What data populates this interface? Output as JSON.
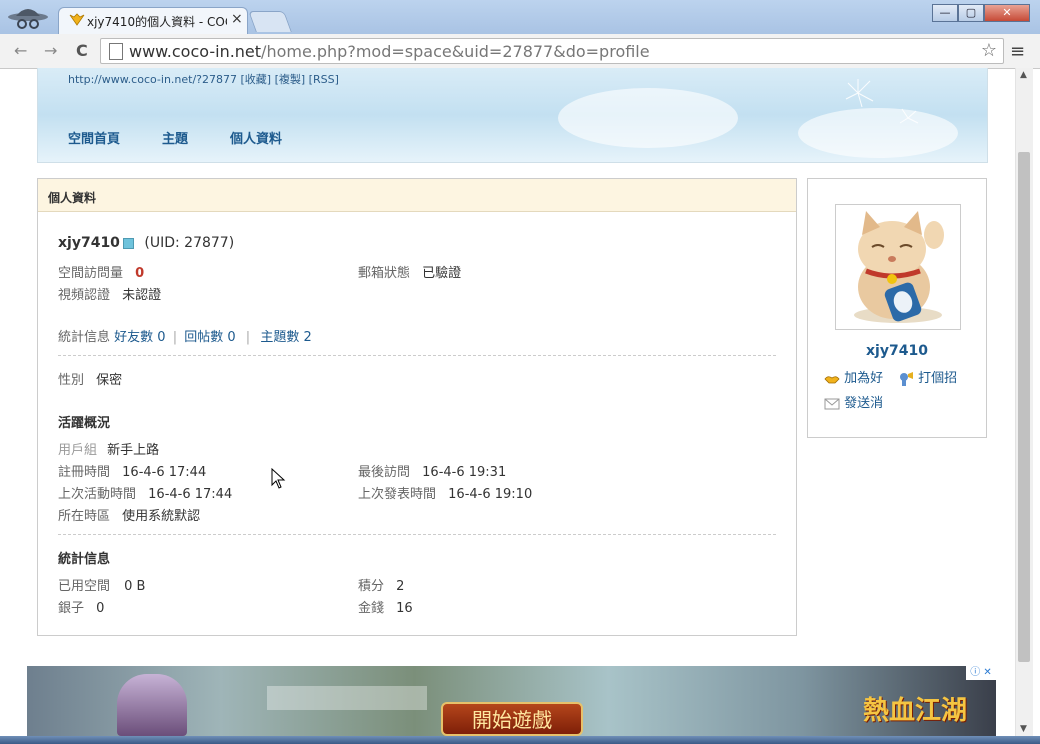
{
  "browser": {
    "tab_title": "xjy7410的個人資料 - COC",
    "tab_close": "×",
    "url_host": "www.coco-in.net",
    "url_path": "/home.php?mod=space&uid=27877&do=profile",
    "back": "←",
    "forward": "→",
    "reload": "C",
    "bookmark": "☆",
    "menu": "≡",
    "win_min": "—",
    "win_max": "▢",
    "win_close": "✕"
  },
  "banner": {
    "space_url": "http://www.coco-in.net/?27877 [收藏] [複製] [RSS]",
    "nav": [
      "空間首頁",
      "主題",
      "個人資料"
    ]
  },
  "profile": {
    "header": "個人資料",
    "username": "xjy7410",
    "uid": "(UID: 27877)",
    "visits_label": "空間訪問量",
    "visits_value": "0",
    "email_label": "郵箱狀態",
    "email_value": "已驗證",
    "video_label": "視頻認證",
    "video_value": "未認證",
    "stats_label": "統計信息",
    "friends": "好友數 0",
    "posts": "回帖數 0",
    "threads": "主題數 2",
    "divider": "|",
    "gender_label": "性別",
    "gender_value": "保密",
    "activity_title": "活躍概況",
    "group_label": "用戶組",
    "group_value": "新手上路",
    "reg_label": "註冊時間",
    "reg_value": "16-4-6 17:44",
    "last_visit_label": "最後訪問",
    "last_visit_value": "16-4-6 19:31",
    "last_active_label": "上次活動時間",
    "last_active_value": "16-4-6 17:44",
    "last_post_label": "上次發表時間",
    "last_post_value": "16-4-6 19:10",
    "tz_label": "所在時區",
    "tz_value": "使用系統默認",
    "stats_title": "統計信息",
    "space_label": "已用空間",
    "space_value": "0 B",
    "points_label": "積分",
    "points_value": "2",
    "silver_label": "銀子",
    "silver_value": "0",
    "money_label": "金錢",
    "money_value": "16"
  },
  "sidebar": {
    "username": "xjy7410",
    "add_friend": "加為好",
    "greet": "打個招",
    "message": "發送消"
  },
  "ad": {
    "button": "開始遊戲",
    "logo": "熱血江湖",
    "badge": "ⓘ ✕"
  }
}
